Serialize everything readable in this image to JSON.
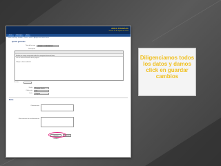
{
  "window": {
    "brand": "AREA TRABAJO",
    "date": "Jueves 15 de agosto de 2013"
  },
  "nav": [
    "Inicio",
    "Mensajes",
    "Foro"
  ],
  "breadcrumb": "Usted está aquí: Moodle > curso > tema > Agregar una tarea nueva",
  "form": {
    "section_general": "Ajustes generales",
    "name_label": "Título de la tarea",
    "name_value": "ENSAYO COMPARATIVO",
    "desc_label": "Descripción",
    "desc_text_1": "Realizar un ensayo comparativo sobre los conceptos básicos del tema,",
    "desc_text_2": "con una extensión mínima de dos páginas.",
    "desc_text_3": "Trabajo en forma individual",
    "file_label": "Archivo",
    "date_label": "Fecha",
    "date_value": "Formato y fecha",
    "grade_label": "Calificación",
    "grade_value": "100",
    "time_label": "Límite",
    "time_value": "Ninguno",
    "section_notes": "Notas",
    "notes_label": "Observaciones",
    "feedback_label": "Observaciones de retroalimentación"
  },
  "buttons": {
    "save": "Guardar cambios",
    "cancel": "Cancelar"
  },
  "callout": {
    "text": "Diligenciamos todos los datos y damos click en guardar cambios"
  },
  "colors": {
    "callout_text": "#f0c020",
    "highlight_circle": "#e0207c",
    "header_bar": "#0c2a57"
  }
}
